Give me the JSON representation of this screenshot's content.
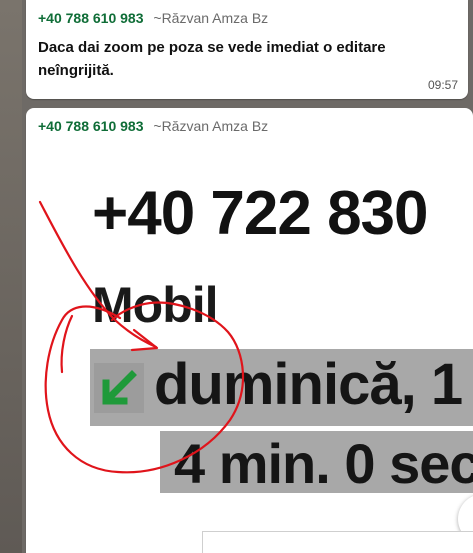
{
  "messages": [
    {
      "sender_phone": "+40 788 610 983",
      "sender_name": "~Răzvan Amza Bz",
      "text": "Daca dai zoom pe poza se vede imediat o editare neîngrijită.",
      "time": "09:57"
    },
    {
      "sender_phone": "+40 788 610 983",
      "sender_name": "~Răzvan Amza Bz",
      "image": {
        "phone_number": "+40 722 830",
        "phone_type": "Mobil",
        "call_date": "duminică, 1",
        "call_duration": "4 min. 0 sec",
        "call_direction_icon": "incoming-call-arrow-icon",
        "highlight_color": "#a8a8a8",
        "arrow_color": "#1f9a3a",
        "annotation_color": "#e0141b"
      }
    }
  ],
  "colors": {
    "sender_phone": "#0f6d37",
    "bubble_bg": "#ffffff",
    "chat_bg": "#6e6a66"
  }
}
